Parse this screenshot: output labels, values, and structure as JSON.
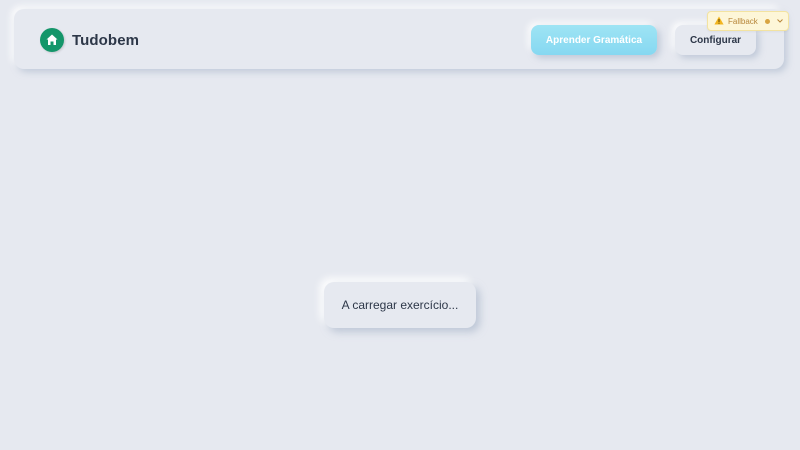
{
  "header": {
    "brand_name": "Tudobem",
    "logo_icon": "house-icon",
    "buttons": {
      "learn_grammar_label": "Aprender Gramática",
      "configure_label": "Configurar"
    }
  },
  "fallback_badge": {
    "label": "Fallback",
    "icon": "warning-icon",
    "status_color": "#d8a441"
  },
  "main": {
    "loading_text": "A carregar exercício..."
  },
  "colors": {
    "background": "#e6e9f0",
    "brand_green": "#14966a",
    "primary_button": "#86d8f1",
    "text_dark": "#2d3748"
  }
}
